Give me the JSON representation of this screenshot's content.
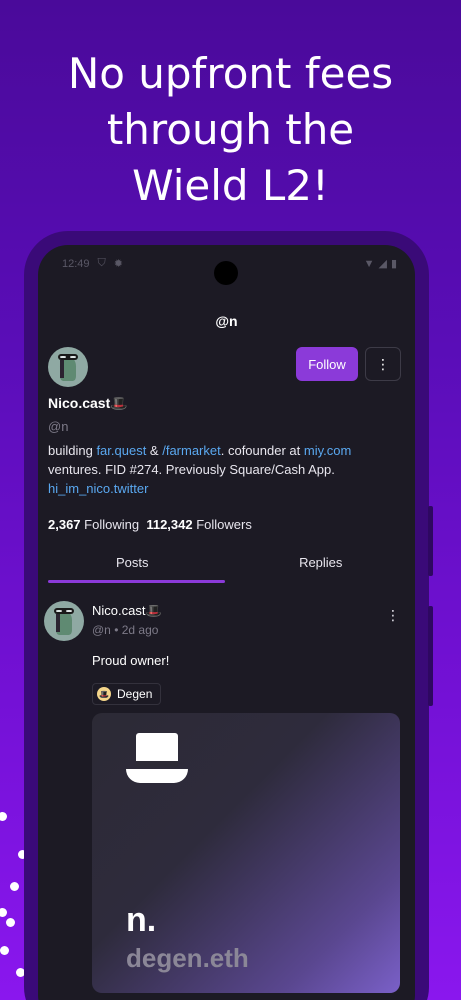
{
  "headline": [
    "No upfront fees",
    "through the",
    "Wield L2!"
  ],
  "status_bar": {
    "time": "12:49"
  },
  "profile": {
    "title": "@n",
    "follow_label": "Follow",
    "more_label": "⋮",
    "name": "Nico.cast🎩",
    "handle": "@n",
    "bio": {
      "p1": "building ",
      "link1": "far.quest",
      "p2": " & ",
      "link2": "/farmarket",
      "p3": ". cofounder at ",
      "link3": "miy.com",
      "p4": " ventures. FID #274. Previously Square/Cash App. ",
      "link4": "hi_im_nico.twitter"
    },
    "following_count": "2,367",
    "following_label": "Following",
    "followers_count": "112,342",
    "followers_label": "Followers"
  },
  "tabs": [
    {
      "label": "Posts",
      "active": true
    },
    {
      "label": "Replies",
      "active": false
    }
  ],
  "post": {
    "name": "Nico.cast🎩",
    "meta": "@n • 2d ago",
    "menu": "⋮",
    "text": "Proud owner!",
    "channel": "Degen",
    "nft_initial": "n.",
    "nft_domain": "degen.eth"
  },
  "colors": {
    "accent": "#8b3ad9",
    "link": "#5aa8f0",
    "background": "#1c1a24"
  }
}
